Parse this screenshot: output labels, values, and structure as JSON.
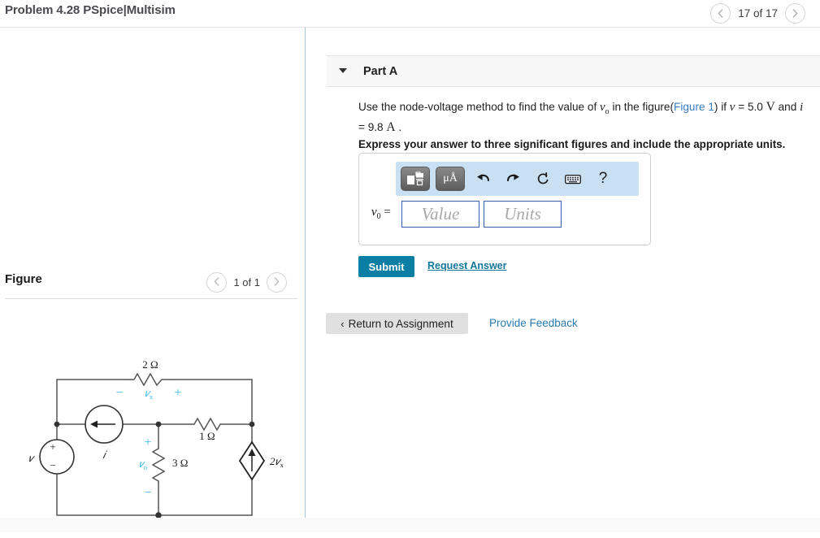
{
  "header": {
    "problem_title": "Problem 4.28 PSpice|Multisim",
    "pager": {
      "prev_icon": "chevron-left-icon",
      "label": "17 of 17",
      "next_icon": "chevron-right-icon"
    }
  },
  "figure_panel": {
    "title": "Figure",
    "pager": {
      "prev_icon": "chevron-left-icon",
      "label": "1 of 1",
      "next_icon": "chevron-right-icon"
    },
    "circuit": {
      "r_top": "2 Ω",
      "vx_label": "v",
      "vx_sub": "x",
      "vx_minus": "−",
      "vx_plus": "+",
      "r_mid": "1 Ω",
      "r_vert": "3 Ω",
      "vo_label": "v",
      "vo_sub": "o",
      "vo_plus": "+",
      "vo_minus": "−",
      "source_v": "v",
      "source_v_plus": "+",
      "source_v_minus": "−",
      "source_i": "i",
      "dep_source": "2v",
      "dep_source_sub": "x"
    }
  },
  "part_a": {
    "caret_icon": "caret-down-icon",
    "label": "Part A",
    "question": {
      "text_1": "Use the node-voltage method to find the value of ",
      "var_vo": "v",
      "var_vo_sub": "o",
      "text_2": " in the figure(",
      "figure_link": "Figure 1",
      "text_3": ") if ",
      "var_v": "v",
      "text_4": " = 5.0 ",
      "unit_v": "V",
      "text_5": " and ",
      "var_i": "i",
      "text_6": " = 9.8 ",
      "unit_a": "A",
      "text_7": " ."
    },
    "instruction": "Express your answer to three significant figures and include the appropriate units.",
    "toolbar": {
      "template_icon": "math-template-icon",
      "units_icon": "micro-angstrom-units-icon",
      "units_label": "μÅ",
      "undo_icon": "undo-arrow-icon",
      "redo_icon": "redo-arrow-icon",
      "reset_icon": "reset-circle-icon",
      "keyboard_icon": "keyboard-icon",
      "help_icon": "help-question-icon",
      "help_label": "?"
    },
    "answer": {
      "prefix_var": "v",
      "prefix_sub": "0",
      "prefix_eq": " =",
      "value_placeholder": "Value",
      "units_placeholder": "Units"
    },
    "submit_label": "Submit",
    "request_answer_label": "Request Answer"
  },
  "footer": {
    "return_chevron": "‹",
    "return_label": "Return to Assignment",
    "feedback_label": "Provide Feedback"
  },
  "colors": {
    "accent_teal": "#0b7fa3",
    "link_blue": "#2a7ab0",
    "toolbar_blue": "#c9e0f2",
    "circuit_cyan": "#39b6e8",
    "field_border": "#3b5ca8"
  }
}
